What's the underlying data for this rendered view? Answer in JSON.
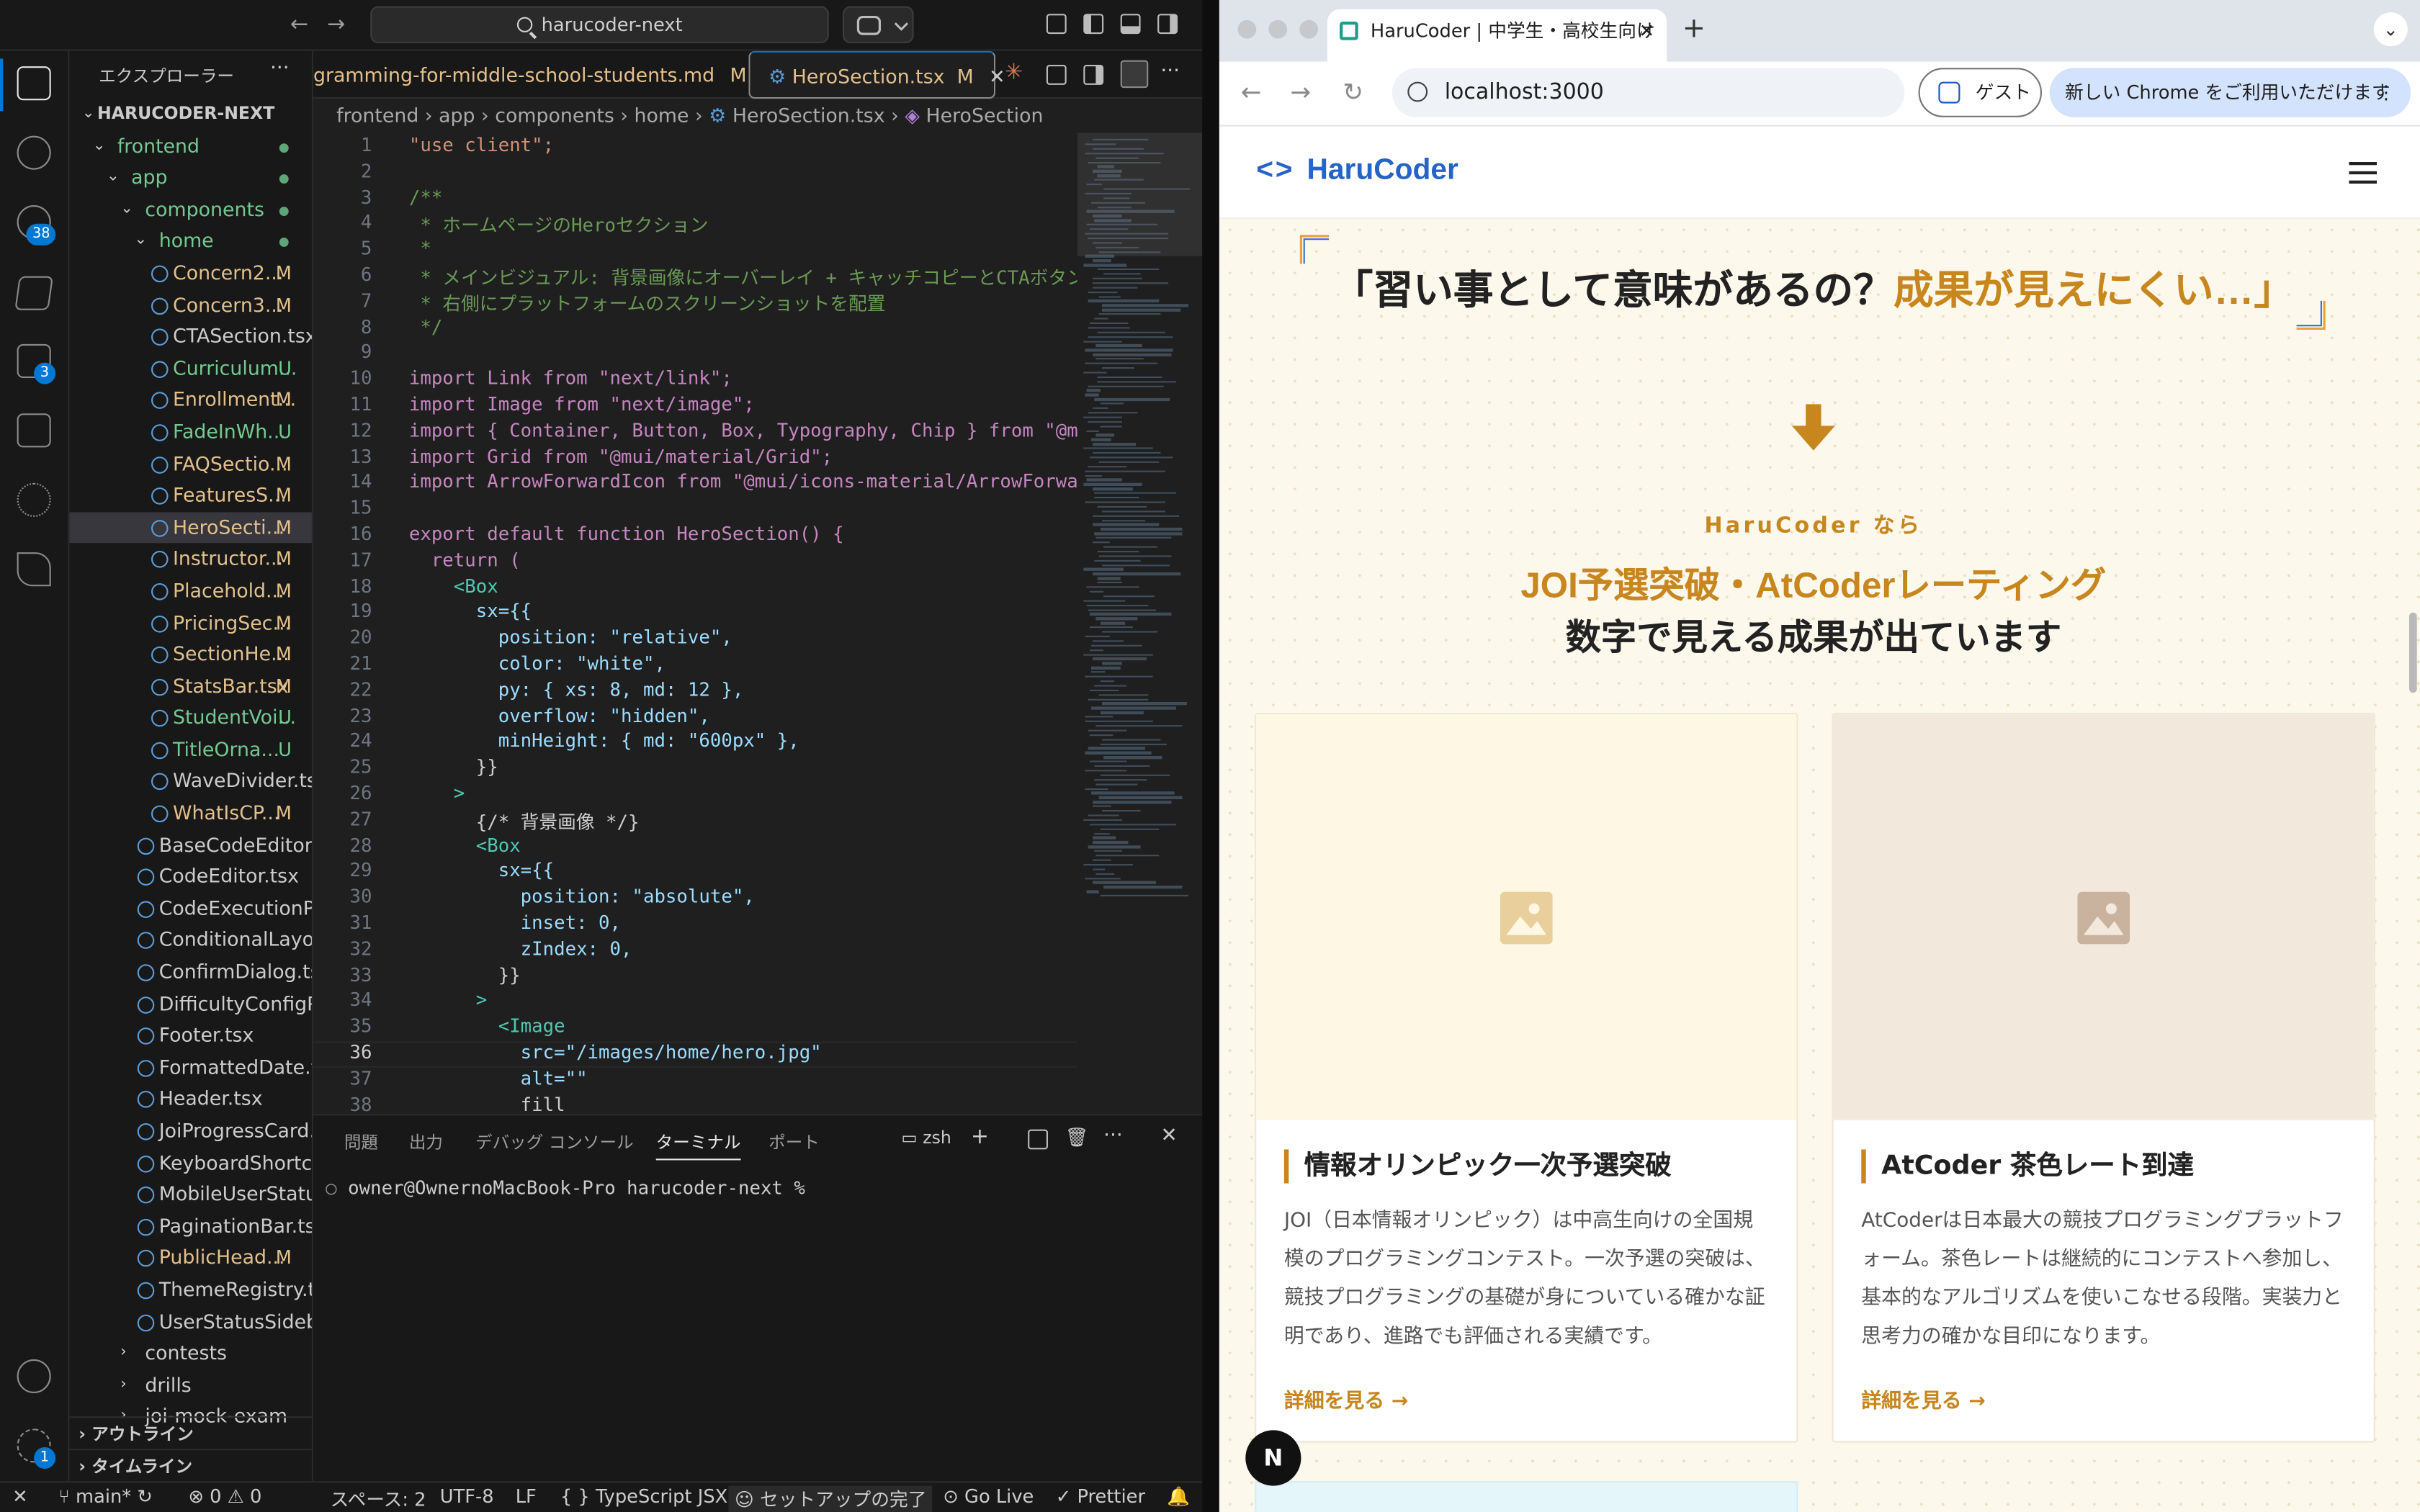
{
  "vscode": {
    "search_text": "harucoder-next",
    "explorer_title": "エクスプローラー",
    "root_folder": "HARUCODER-NEXT",
    "source_control_badge": "38",
    "extensions_badge": "3",
    "settings_badge": "1",
    "tree": [
      {
        "name": "frontend",
        "type": "folder",
        "indent": 1,
        "status": "dot"
      },
      {
        "name": "app",
        "type": "folder",
        "indent": 2,
        "status": "dot"
      },
      {
        "name": "components",
        "type": "folder",
        "indent": 3,
        "status": "dot"
      },
      {
        "name": "home",
        "type": "folder",
        "indent": 4,
        "status": "dot"
      },
      {
        "name": "Concern2...",
        "type": "file",
        "indent": 5,
        "status": "M"
      },
      {
        "name": "Concern3...",
        "type": "file",
        "indent": 5,
        "status": "M"
      },
      {
        "name": "CTASection.tsx",
        "type": "file",
        "indent": 5,
        "status": ""
      },
      {
        "name": "Curriculum...",
        "type": "file",
        "indent": 5,
        "status": "U"
      },
      {
        "name": "Enrollment...",
        "type": "file",
        "indent": 5,
        "status": "M"
      },
      {
        "name": "FadeInWh...",
        "type": "file",
        "indent": 5,
        "status": "U"
      },
      {
        "name": "FAQSectio...",
        "type": "file",
        "indent": 5,
        "status": "M"
      },
      {
        "name": "FeaturesS...",
        "type": "file",
        "indent": 5,
        "status": "M"
      },
      {
        "name": "HeroSecti...",
        "type": "file",
        "indent": 5,
        "status": "M",
        "selected": true
      },
      {
        "name": "Instructor...",
        "type": "file",
        "indent": 5,
        "status": "M"
      },
      {
        "name": "Placehold...",
        "type": "file",
        "indent": 5,
        "status": "M"
      },
      {
        "name": "PricingSec...",
        "type": "file",
        "indent": 5,
        "status": "M"
      },
      {
        "name": "SectionHe...",
        "type": "file",
        "indent": 5,
        "status": "M"
      },
      {
        "name": "StatsBar.tsx",
        "type": "file",
        "indent": 5,
        "status": "M"
      },
      {
        "name": "StudentVoi...",
        "type": "file",
        "indent": 5,
        "status": "U"
      },
      {
        "name": "TitleOrna...",
        "type": "file",
        "indent": 5,
        "status": "U"
      },
      {
        "name": "WaveDivider.tsx",
        "type": "file",
        "indent": 5,
        "status": ""
      },
      {
        "name": "WhatIsCP...",
        "type": "file",
        "indent": 5,
        "status": "M"
      },
      {
        "name": "BaseCodeEditor....",
        "type": "file",
        "indent": 4,
        "status": ""
      },
      {
        "name": "CodeEditor.tsx",
        "type": "file",
        "indent": 4,
        "status": ""
      },
      {
        "name": "CodeExecutionP...",
        "type": "file",
        "indent": 4,
        "status": ""
      },
      {
        "name": "ConditionalLayou...",
        "type": "file",
        "indent": 4,
        "status": ""
      },
      {
        "name": "ConfirmDialog.tsx",
        "type": "file",
        "indent": 4,
        "status": ""
      },
      {
        "name": "DifficultyConfigP...",
        "type": "file",
        "indent": 4,
        "status": ""
      },
      {
        "name": "Footer.tsx",
        "type": "file",
        "indent": 4,
        "status": ""
      },
      {
        "name": "FormattedDate.tsx",
        "type": "file",
        "indent": 4,
        "status": ""
      },
      {
        "name": "Header.tsx",
        "type": "file",
        "indent": 4,
        "status": ""
      },
      {
        "name": "JoiProgressCard....",
        "type": "file",
        "indent": 4,
        "status": ""
      },
      {
        "name": "KeyboardShortc...",
        "type": "file",
        "indent": 4,
        "status": ""
      },
      {
        "name": "MobileUserStatu...",
        "type": "file",
        "indent": 4,
        "status": ""
      },
      {
        "name": "PaginationBar.tsx",
        "type": "file",
        "indent": 4,
        "status": ""
      },
      {
        "name": "PublicHead...",
        "type": "file",
        "indent": 4,
        "status": "M"
      },
      {
        "name": "ThemeRegistry.tsx",
        "type": "file",
        "indent": 4,
        "status": ""
      },
      {
        "name": "UserStatusSideb...",
        "type": "file",
        "indent": 4,
        "status": ""
      },
      {
        "name": "contests",
        "type": "closed",
        "indent": 3,
        "status": ""
      },
      {
        "name": "drills",
        "type": "closed",
        "indent": 3,
        "status": ""
      },
      {
        "name": "joi-mock-exam",
        "type": "closed",
        "indent": 3,
        "status": ""
      }
    ],
    "outline_label": "アウトライン",
    "timeline_label": "タイムライン",
    "tabs": [
      {
        "label": "gramming-for-middle-school-students.md",
        "status": "M"
      },
      {
        "label": "HeroSection.tsx",
        "status": "M"
      }
    ],
    "breadcrumb": [
      "frontend",
      "app",
      "components",
      "home",
      "HeroSection.tsx",
      "HeroSection"
    ],
    "current_line": 36,
    "code_lines": [
      "\"use client\";",
      "",
      "/**",
      " * ホームページのHeroセクション",
      " *",
      " * メインビジュアル: 背景画像にオーバーレイ + キャッチコピーとCTAボタン",
      " * 右側にプラットフォームのスクリーンショットを配置",
      " */",
      "",
      "import Link from \"next/link\";",
      "import Image from \"next/image\";",
      "import { Container, Button, Box, Typography, Chip } from \"@mui/ma",
      "import Grid from \"@mui/material/Grid\";",
      "import ArrowForwardIcon from \"@mui/icons-material/ArrowForward\";",
      "",
      "export default function HeroSection() {",
      "  return (",
      "    <Box",
      "      sx={{",
      "        position: \"relative\",",
      "        color: \"white\",",
      "        py: { xs: 8, md: 12 },",
      "        overflow: \"hidden\",",
      "        minHeight: { md: \"600px\" },",
      "      }}",
      "    >",
      "      {/* 背景画像 */}",
      "      <Box",
      "        sx={{",
      "          position: \"absolute\",",
      "          inset: 0,",
      "          zIndex: 0,",
      "        }}",
      "      >",
      "        <Image",
      "          src=\"/images/home/hero.jpg\"",
      "          alt=\"\"",
      "          fill"
    ],
    "panel_tabs": [
      "問題",
      "出力",
      "デバッグ コンソール",
      "ターミナル",
      "ポート"
    ],
    "active_panel": "ターミナル",
    "shell": "zsh",
    "terminal_prompt": "owner@OwnernoMacBook-Pro harucoder-next %",
    "status": {
      "branch": "main*",
      "errors": "0",
      "warnings": "0",
      "spaces": "スペース: 2",
      "encoding": "UTF-8",
      "eol": "LF",
      "language": "TypeScript JSX",
      "setup": "セットアップの完了",
      "golive": "Go Live",
      "prettier": "Prettier"
    }
  },
  "chrome": {
    "tab_title": "HaruCoder | 中学生・高校生向け",
    "url": "localhost:3000",
    "guest_label": "ゲスト",
    "new_chrome_label": "新しい Chrome をご利用いただけます"
  },
  "site": {
    "logo_text": "HaruCoder",
    "quote_main": "「習い事として意味があるの？",
    "quote_highlight": "成果が見えにくい…」",
    "sub_label": "HaruCoder なら",
    "headline_accent": "JOI予選突破・AtCoderレーティング",
    "headline_main": "数字で見える成果が出ています",
    "cards": [
      {
        "title": "情報オリンピック一次予選突破",
        "desc": "JOI（日本情報オリンピック）は中高生向けの全国規模のプログラミングコンテスト。一次予選の突破は、競技プログラミングの基礎が身についている確かな証明であり、進路でも評価される実績です。",
        "link": "詳細を見る",
        "bg": "#fdf7e4"
      },
      {
        "title": "AtCoder 茶色レート到達",
        "desc": "AtCoderは日本最大の競技プログラミングプラットフォーム。茶色レートは継続的にコンテストへ参加し、基本的なアルゴリズムを使いこなせる段階。実装力と思考力の確かな目印になります。",
        "link": "詳細を見る",
        "bg": "#f2e9dc"
      }
    ],
    "accent_color": "#c8861e",
    "brand_color": "#2563c8",
    "dev_badge": "N"
  }
}
